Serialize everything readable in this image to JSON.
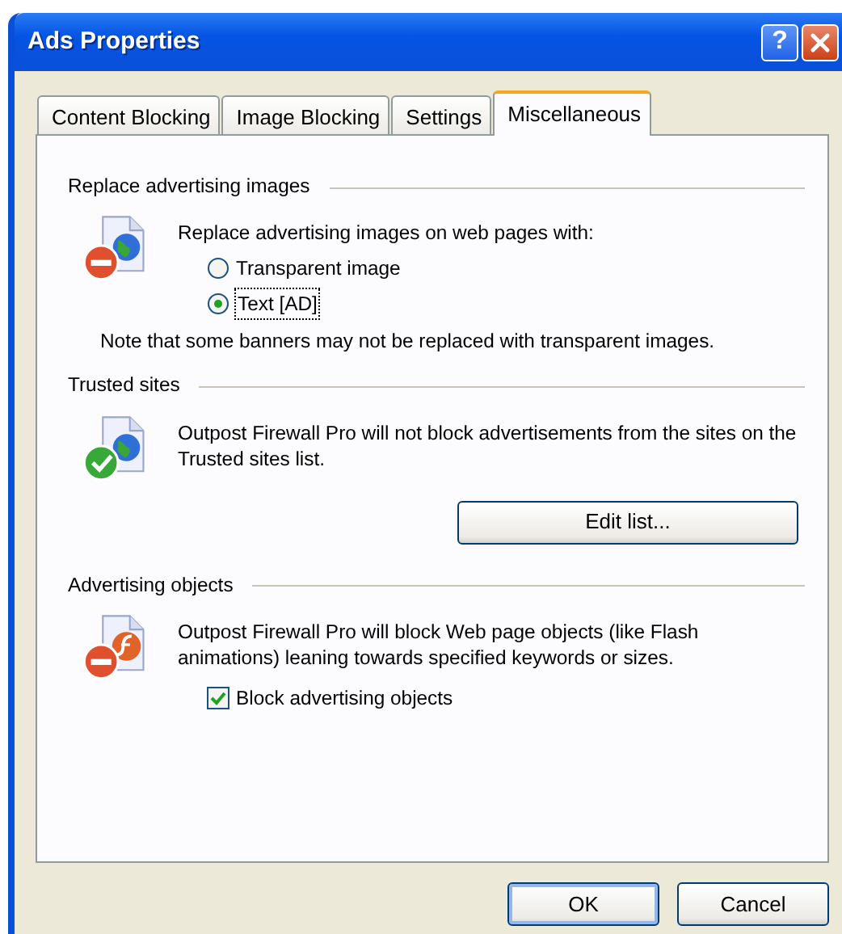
{
  "window": {
    "title": "Ads Properties",
    "help_button": "?"
  },
  "tabs": [
    {
      "label": "Content Blocking",
      "selected": false
    },
    {
      "label": "Image Blocking",
      "selected": false
    },
    {
      "label": "Settings",
      "selected": false
    },
    {
      "label": "Miscellaneous",
      "selected": true
    }
  ],
  "sections": [
    {
      "title": "Replace advertising images",
      "kind": "blocked-page",
      "items": [
        {
          "kind": "text",
          "text": "Replace advertising images on web pages with:"
        },
        {
          "kind": "radio",
          "label": "Transparent image",
          "selected": false,
          "focused": false
        },
        {
          "kind": "radio",
          "label": "Text [AD]",
          "selected": true,
          "focused": true
        },
        {
          "kind": "note",
          "text": "Note that some banners may not be replaced with transparent images."
        }
      ]
    },
    {
      "title": "Trusted sites",
      "kind": "trusted-page",
      "items": [
        {
          "kind": "text",
          "text": "Outpost Firewall Pro will not block advertisements from the sites on the Trusted sites list."
        },
        {
          "kind": "button",
          "label": "Edit list..."
        }
      ]
    },
    {
      "title": "Advertising objects",
      "kind": "blocked-flash",
      "items": [
        {
          "kind": "text",
          "text": "Outpost Firewall Pro will block Web page objects (like Flash animations) leaning towards specified keywords or sizes."
        },
        {
          "kind": "checkbox",
          "label": "Block advertising objects",
          "checked": true
        }
      ]
    }
  ],
  "buttons": [
    {
      "label": "OK",
      "default": true
    },
    {
      "label": "Cancel",
      "default": false
    }
  ]
}
